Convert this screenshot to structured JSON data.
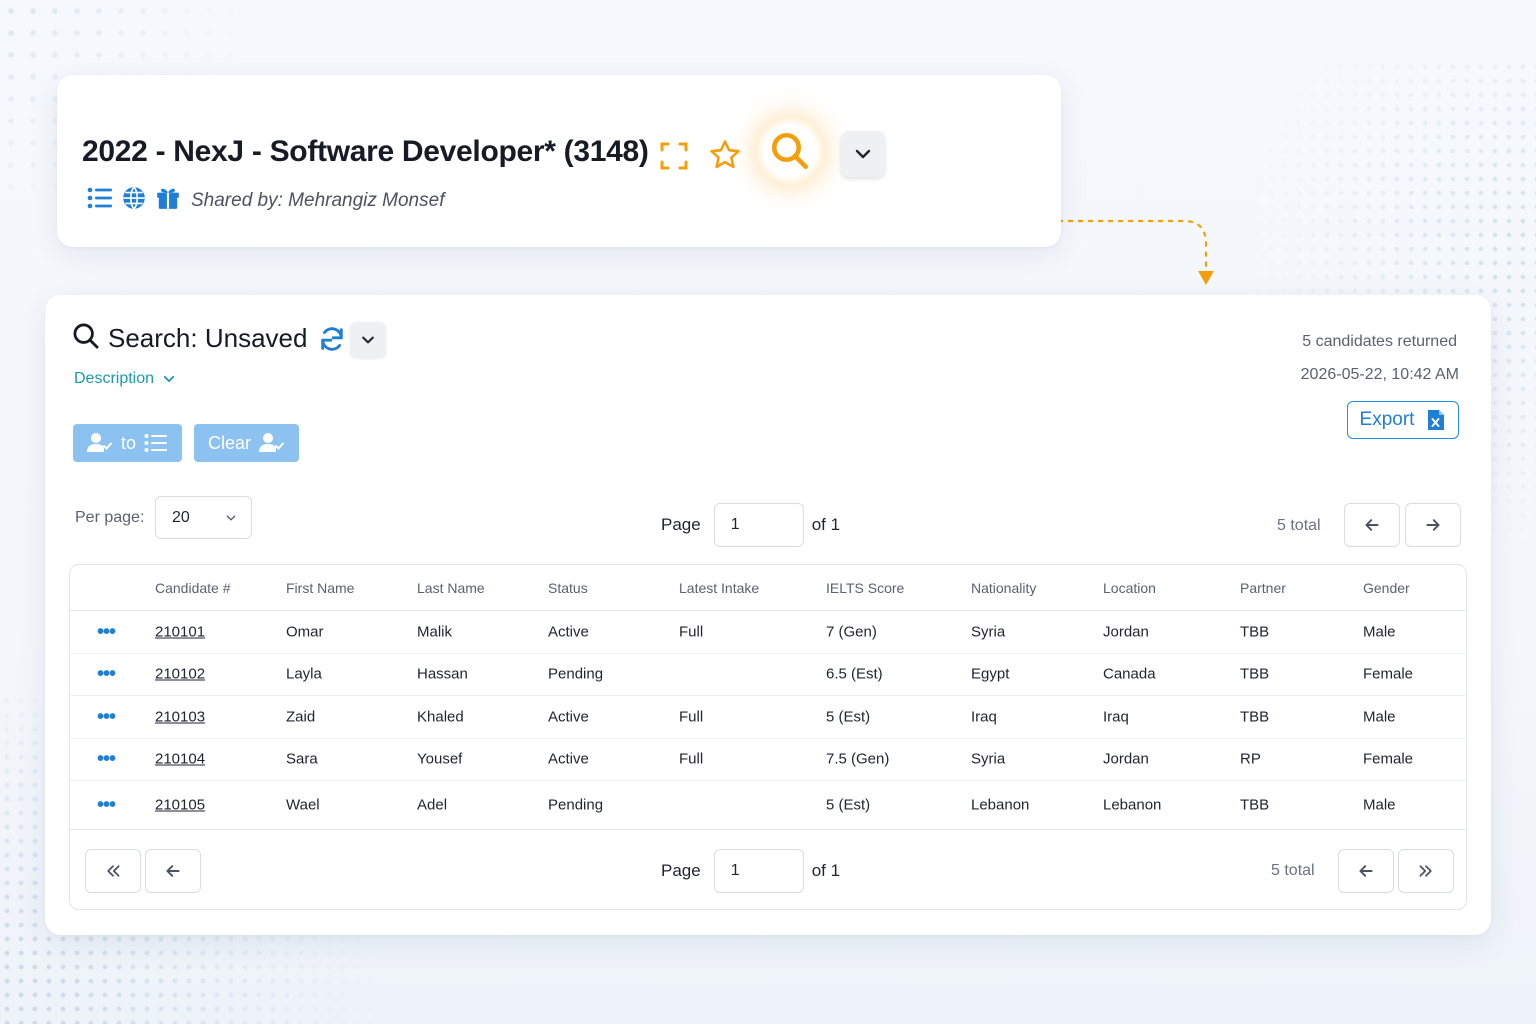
{
  "colors": {
    "accent_orange": "#f59e0b",
    "accent_blue": "#1f7fd6",
    "teal_link": "#1a9ab0",
    "pill_button": "#8cc2ef"
  },
  "job": {
    "title": "2022 - NexJ - Software Developer* (3148)",
    "shared_by": "Shared by: Mehrangiz Monsef",
    "icons": [
      "expand-icon",
      "star-icon",
      "search-icon",
      "chevron-down-icon",
      "list-icon",
      "globe-icon",
      "gift-icon"
    ]
  },
  "search": {
    "title": "Search: Unsaved",
    "description_label": "Description",
    "candidates_returned": "5 candidates returned",
    "timestamp": "2026-05-22, 10:42 AM",
    "export_label": "Export",
    "to_label": "to",
    "clear_label": "Clear"
  },
  "pagination": {
    "per_page_label": "Per page:",
    "per_page_value": "20",
    "page_label": "Page",
    "page_value": "1",
    "of_label": "of 1",
    "total_label": "5 total"
  },
  "table": {
    "columns": [
      "Candidate #",
      "First Name",
      "Last Name",
      "Status",
      "Latest Intake",
      "IELTS Score",
      "Nationality",
      "Location",
      "Partner",
      "Gender"
    ],
    "rows": [
      {
        "candidate": "210101",
        "first": "Omar",
        "last": "Malik",
        "status": "Active",
        "intake": "Full",
        "ielts": "7 (Gen)",
        "nationality": "Syria",
        "location": "Jordan",
        "partner": "TBB",
        "gender": "Male"
      },
      {
        "candidate": "210102",
        "first": "Layla",
        "last": "Hassan",
        "status": "Pending",
        "intake": "",
        "ielts": "6.5 (Est)",
        "nationality": "Egypt",
        "location": "Canada",
        "partner": "TBB",
        "gender": "Female"
      },
      {
        "candidate": "210103",
        "first": "Zaid",
        "last": "Khaled",
        "status": "Active",
        "intake": "Full",
        "ielts": "5 (Est)",
        "nationality": "Iraq",
        "location": "Iraq",
        "partner": "TBB",
        "gender": "Male"
      },
      {
        "candidate": "210104",
        "first": "Sara",
        "last": "Yousef",
        "status": "Active",
        "intake": "Full",
        "ielts": "7.5 (Gen)",
        "nationality": "Syria",
        "location": "Jordan",
        "partner": "RP",
        "gender": "Female"
      },
      {
        "candidate": "210105",
        "first": "Wael",
        "last": "Adel",
        "status": "Pending",
        "intake": "",
        "ielts": "5 (Est)",
        "nationality": "Lebanon",
        "location": "Lebanon",
        "partner": "TBB",
        "gender": "Male"
      }
    ]
  }
}
